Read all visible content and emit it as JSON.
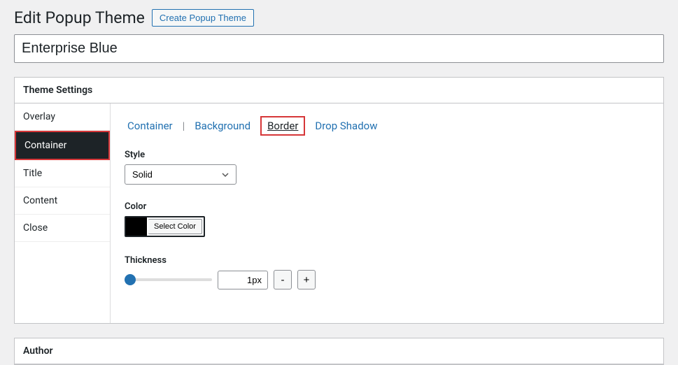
{
  "header": {
    "title": "Edit Popup Theme",
    "create_label": "Create Popup Theme"
  },
  "theme_name": "Enterprise Blue",
  "settings_panel": {
    "heading": "Theme Settings"
  },
  "sidebar": {
    "items": [
      {
        "label": "Overlay"
      },
      {
        "label": "Container"
      },
      {
        "label": "Title"
      },
      {
        "label": "Content"
      },
      {
        "label": "Close"
      }
    ],
    "active_index": 1
  },
  "subtabs": {
    "items": [
      {
        "label": "Container"
      },
      {
        "label": "Background"
      },
      {
        "label": "Border"
      },
      {
        "label": "Drop Shadow"
      }
    ],
    "active_index": 2
  },
  "border": {
    "style_label": "Style",
    "style_value": "Solid",
    "color_label": "Color",
    "color_value": "#000000",
    "select_color_label": "Select Color",
    "thickness_label": "Thickness",
    "thickness_value": "1px",
    "minus_label": "-",
    "plus_label": "+"
  },
  "author_panel": {
    "heading": "Author"
  }
}
